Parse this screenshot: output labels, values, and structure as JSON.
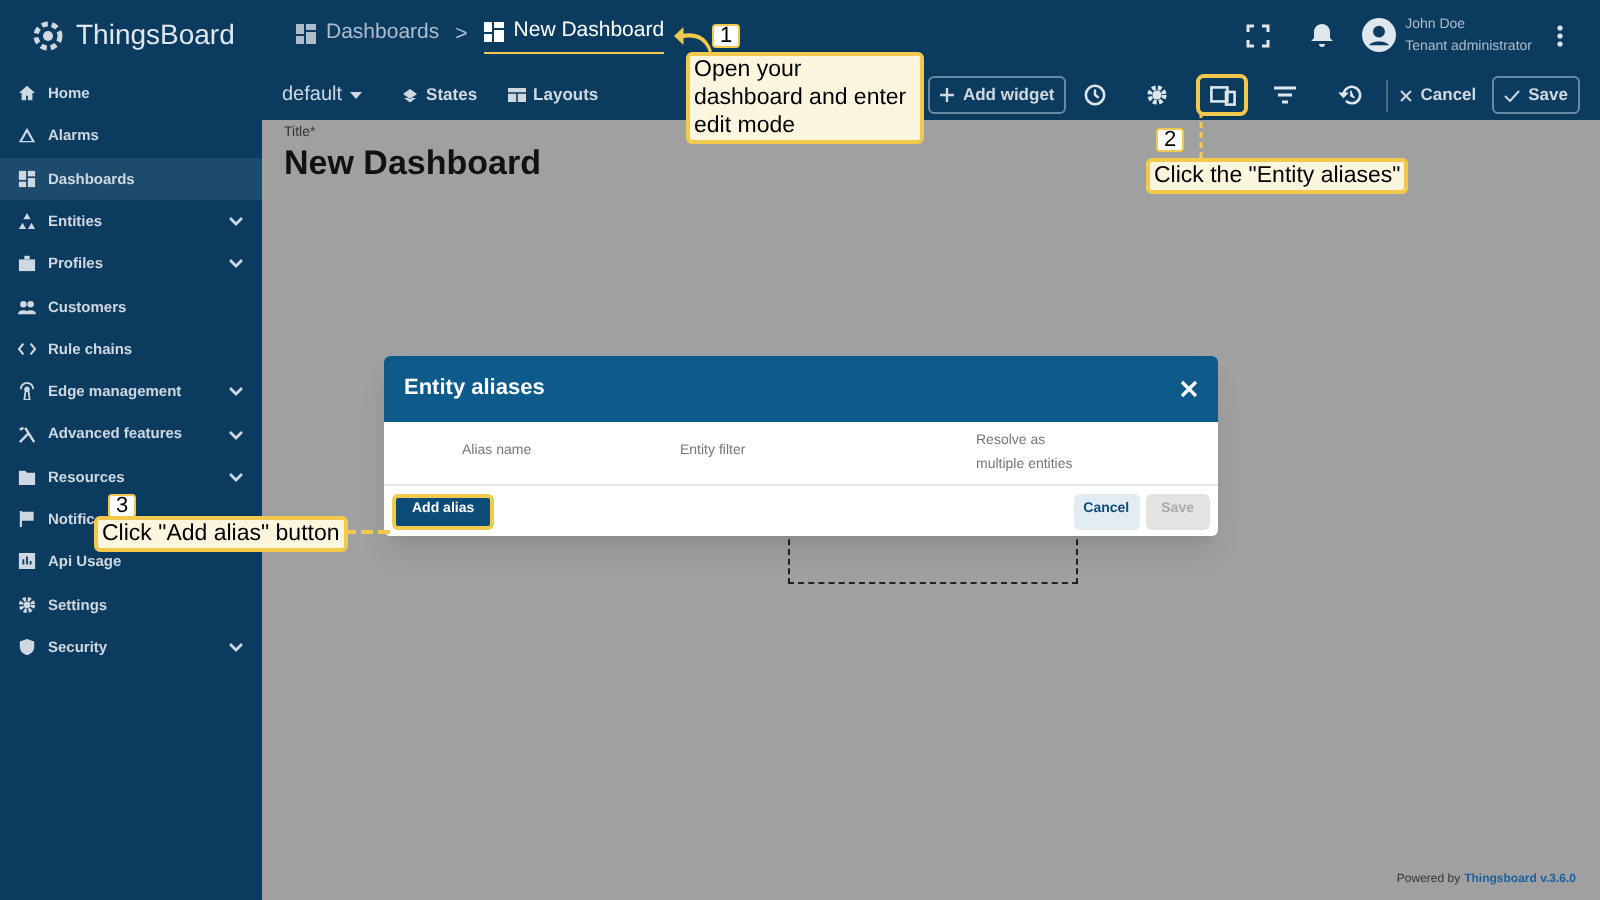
{
  "app": {
    "brand": "ThingsBoard"
  },
  "breadcrumbs": [
    {
      "label": "Dashboards",
      "selected": false
    },
    {
      "label": "New Dashboard",
      "selected": true
    }
  ],
  "breadcrumb_separator": ">",
  "user": {
    "name": "John Doe",
    "role": "Tenant administrator"
  },
  "sidebar": {
    "items": [
      {
        "label": "Home",
        "selected": false,
        "expandable": false
      },
      {
        "label": "Alarms",
        "selected": false,
        "expandable": false
      },
      {
        "label": "Dashboards",
        "selected": true,
        "expandable": false
      },
      {
        "label": "Entities",
        "selected": false,
        "expandable": true
      },
      {
        "label": "Profiles",
        "selected": false,
        "expandable": true
      },
      {
        "label": "Customers",
        "selected": false,
        "expandable": false
      },
      {
        "label": "Rule chains",
        "selected": false,
        "expandable": false
      },
      {
        "label": "Edge management",
        "selected": false,
        "expandable": true
      },
      {
        "label": "Advanced features",
        "selected": false,
        "expandable": true
      },
      {
        "label": "Resources",
        "selected": false,
        "expandable": true
      },
      {
        "label": "Notific",
        "selected": false,
        "expandable": false
      },
      {
        "label": "Api Usage",
        "selected": false,
        "expandable": false
      },
      {
        "label": "Settings",
        "selected": false,
        "expandable": false
      },
      {
        "label": "Security",
        "selected": false,
        "expandable": true
      }
    ]
  },
  "toolbar": {
    "state": "default",
    "states": "States",
    "layouts": "Layouts",
    "add_widget": "Add widget",
    "cancel": "Cancel",
    "save": "Save"
  },
  "dashboard": {
    "title_label": "Title*",
    "title": "New Dashboard"
  },
  "dialog": {
    "title": "Entity aliases",
    "columns": [
      "Alias name",
      "Entity filter",
      "Resolve as multiple entities"
    ],
    "add_button": "Add alias",
    "cancel_button": "Cancel",
    "save_button": {
      "label": "Save",
      "disabled": true
    }
  },
  "callouts": [
    {
      "number": "1",
      "text": "Open your dashboard and enter edit mode"
    },
    {
      "number": "2",
      "text": "Click the \"Entity aliases\""
    },
    {
      "number": "3",
      "text": "Click \"Add alias\" button"
    }
  ],
  "footer": {
    "prefix": "Powered by",
    "link": "Thingsboard v.3.6.0"
  }
}
